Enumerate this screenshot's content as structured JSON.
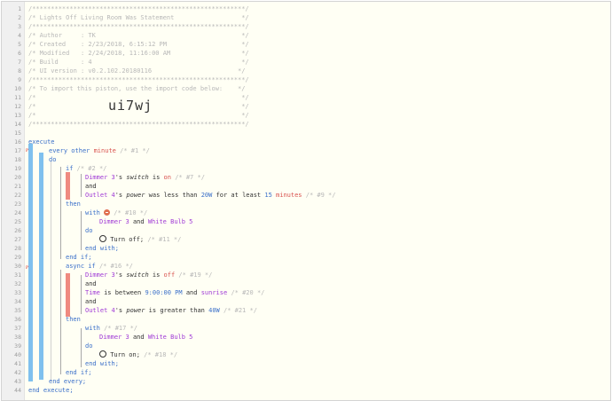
{
  "header": {
    "stars": "/*********************************************************/",
    "title": "/* Lights Off Living Room Was Statement                  */",
    "author": "/* Author     : TK                                       */",
    "created": "/* Created    : 2/23/2018, 6:15:12 PM                    */",
    "modified": "/* Modified   : 2/24/2018, 11:16:00 AM                   */",
    "build": "/* Build      : 4                                        */",
    "ui_version": "/* UI version : v0.2.102.20180116                       */",
    "import_note": "/* To import this piston, use the import code below:    */",
    "blank": "/*                                                       */",
    "code_prefix": "/*",
    "code_suffix": "*/",
    "import_code": "ui7wj"
  },
  "lines": {
    "n": [
      "1",
      "2",
      "3",
      "4",
      "5",
      "6",
      "7",
      "8",
      "9",
      "10",
      "11",
      "12",
      "13",
      "14",
      "15",
      "16",
      "17",
      "18",
      "19",
      "20",
      "21",
      "22",
      "23",
      "24",
      "25",
      "26",
      "27",
      "28",
      "29",
      "30",
      "31",
      "32",
      "33",
      "34",
      "35",
      "36",
      "37",
      "38",
      "39",
      "40",
      "41",
      "42",
      "43",
      "44"
    ]
  },
  "code": {
    "execute": "execute",
    "every": "every",
    "other": "other",
    "minute": "minute",
    "c1": "/* #1 */",
    "do": "do",
    "if": "if",
    "c2": "/* #2 */",
    "dimmer3": "Dimmer 3",
    "s_switch": "'s",
    "switch": "switch",
    "is": "is",
    "on": "on",
    "c7": "/* #7 */",
    "and": "and",
    "outlet4": "Outlet 4",
    "power": "power",
    "was_less": "was less than",
    "w20": "20W",
    "for_at_least": "for at least",
    "n15": "15",
    "minutes": "minutes",
    "c9": "/* #9 */",
    "then": "then",
    "with": "with",
    "c10": "/* #10 */",
    "white_bulb5": "White Bulb 5",
    "turn_off": "Turn off;",
    "c11": "/* #11 */",
    "end_with": "end with;",
    "end_if": "end if;",
    "async_if": "async if",
    "c16": "/* #16 */",
    "off": "off",
    "c19": "/* #19 */",
    "time": "Time",
    "between": "is between",
    "t900": "9:00:00 PM",
    "sunrise": "sunrise",
    "c20": "/* #20 */",
    "greater": "is greater than",
    "w40": "40W",
    "c21": "/* #21 */",
    "c17": "/* #17 */",
    "turn_on": "Turn on;",
    "c18": "/* #18 */",
    "end_every": "end every;",
    "end_execute": "end execute;"
  },
  "icons": {
    "pin1": "pin-icon",
    "pin2": "pin-icon",
    "stop": "stop-icon",
    "power_off": "power-icon",
    "power_on": "power-icon"
  },
  "colors": {
    "keyword": "#3a6fc9",
    "device": "#a03ad6",
    "comment": "#b8b8b8",
    "condition_bar": "#ef8a80",
    "block_bar": "#7fc0ee"
  }
}
